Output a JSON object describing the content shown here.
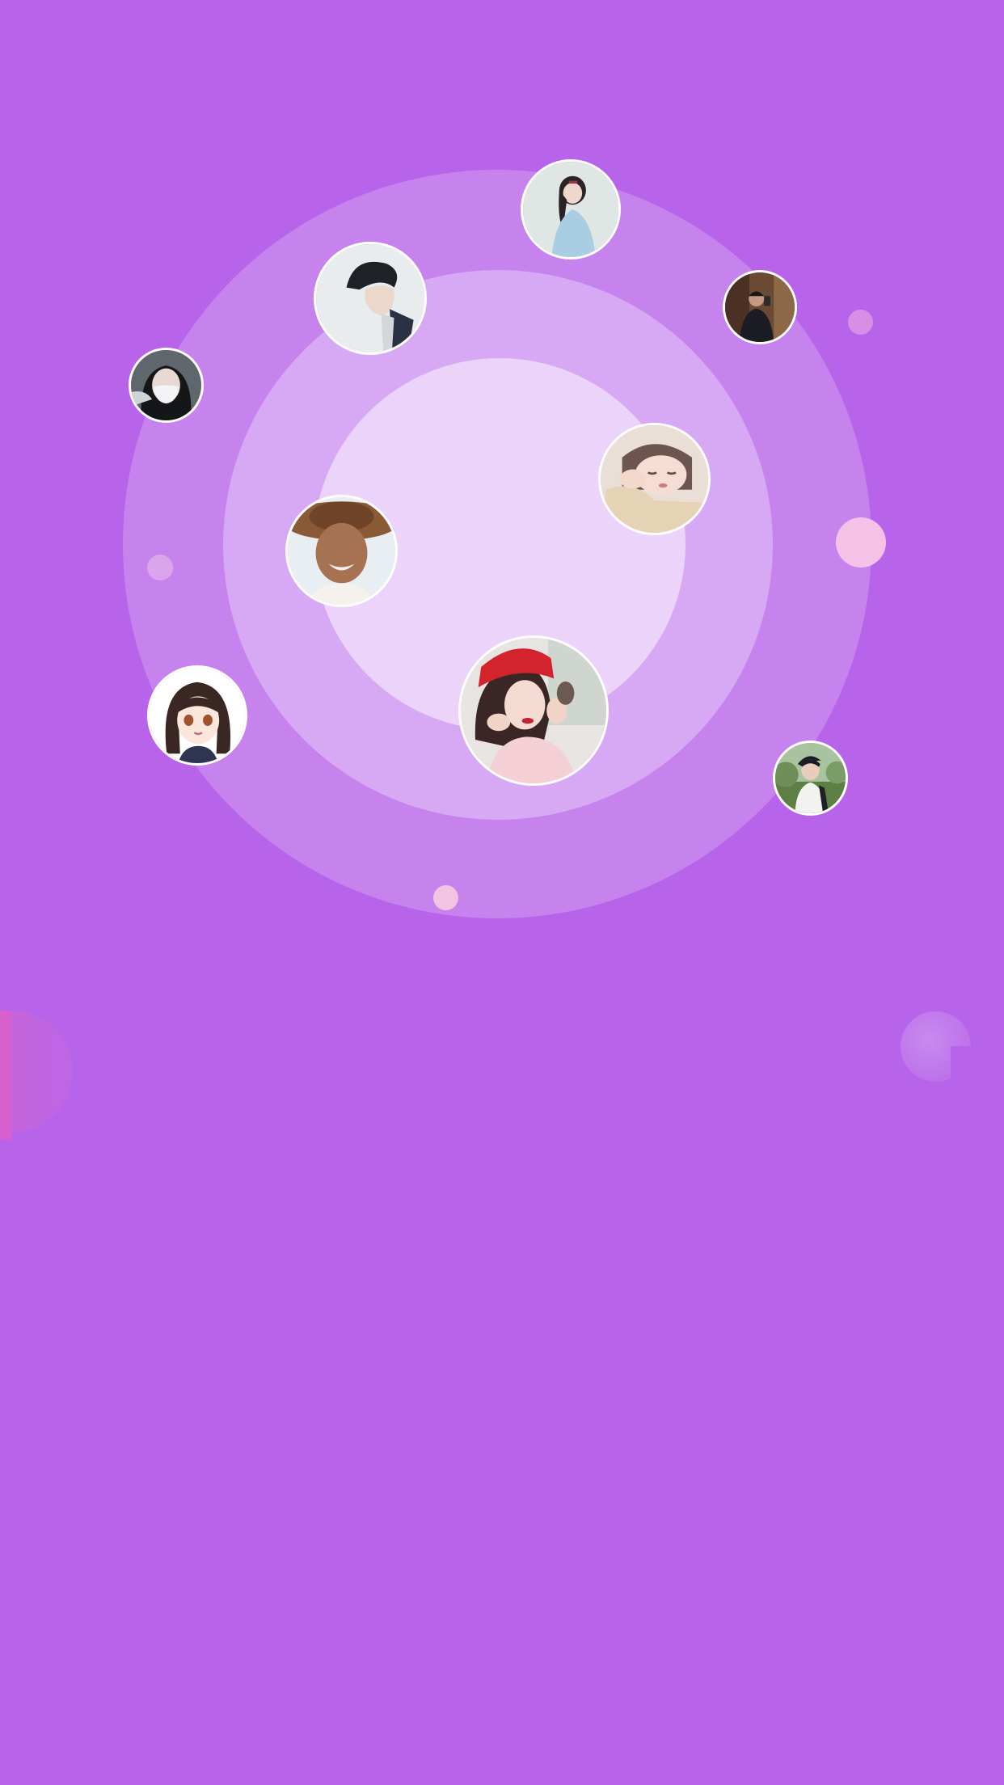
{
  "theme": {
    "background": "#b864ea",
    "ring_outer": "#c682ed",
    "ring_middle": "#d7a8f3",
    "ring_inner": "#ecd3f9",
    "avatar_border": "#ffffff",
    "accent_pink": "#f4c2e6"
  },
  "radar": {
    "avatars": [
      {
        "name": "user-avatar-1",
        "icon": "girl-hanfu-avatar"
      },
      {
        "name": "user-avatar-2",
        "icon": "boy-dark-hair-avatar"
      },
      {
        "name": "user-avatar-3",
        "icon": "man-selfie-avatar"
      },
      {
        "name": "user-avatar-4",
        "icon": "girl-mask-avatar"
      },
      {
        "name": "user-avatar-5",
        "icon": "sleeping-child-avatar"
      },
      {
        "name": "user-avatar-6",
        "icon": "straw-hat-avatar"
      },
      {
        "name": "user-avatar-7",
        "icon": "anime-girl-avatar"
      },
      {
        "name": "user-avatar-8",
        "icon": "red-hat-girl-avatar"
      },
      {
        "name": "user-avatar-9",
        "icon": "boy-outdoor-avatar"
      }
    ]
  }
}
